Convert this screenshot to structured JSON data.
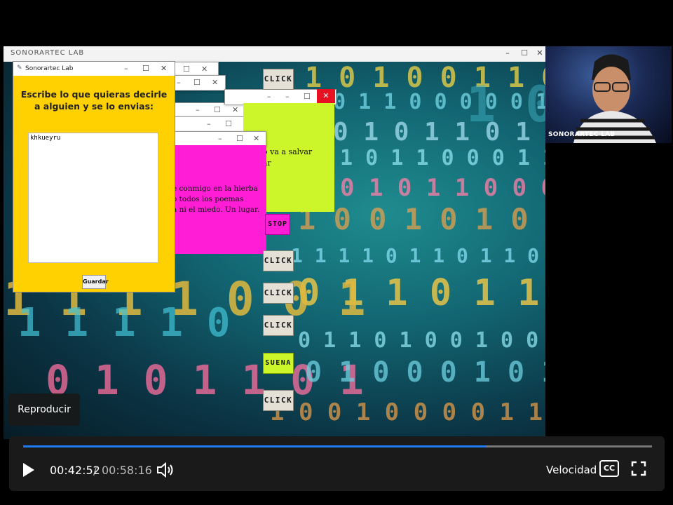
{
  "host_window": {
    "title": "SONORARTEC LAB"
  },
  "main_window": {
    "title": "Sonorartec Lab",
    "prompt": "Escribe lo que quieras decirle a alguien y se lo envias:",
    "text_value": "khkueyru",
    "save_label": "Guardar"
  },
  "magenta_window": {
    "text": "e conmigo en la hierba\no todos los poemas\na ni el miedo. Un lugar."
  },
  "lime_window": {
    "text": "o va a salvar\nar"
  },
  "buttons": {
    "click": "CLICK",
    "stop": "STOP",
    "suena": "SUENA"
  },
  "webcam": {
    "label": "SONORARTEC LAB"
  },
  "player": {
    "tooltip": "Reproducir",
    "current_time": "00:42:52",
    "separator": "/",
    "total_time": "00:58:16",
    "speed_label": "Velocidad",
    "cc_label": "CC",
    "progress": 0.7357
  },
  "colors": {
    "main_window_bg": "#ffd100",
    "magenta_window_bg": "#ff1ed6",
    "lime_window_bg": "#ccf52a",
    "progress": "#1e7cf2"
  }
}
